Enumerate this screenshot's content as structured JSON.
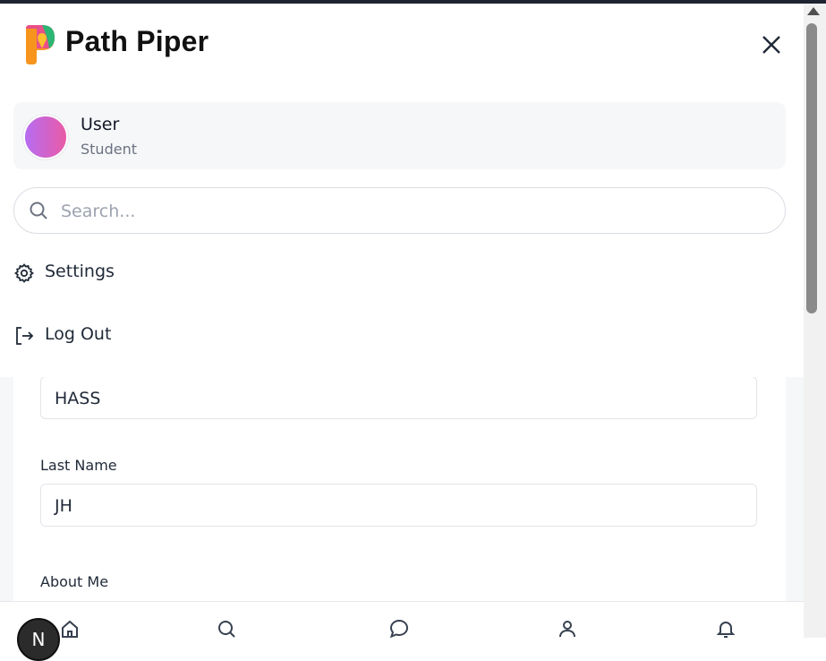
{
  "brand": {
    "name": "Path Piper"
  },
  "drawer": {
    "user": {
      "name": "User",
      "role": "Student"
    },
    "search": {
      "placeholder": "Search..."
    },
    "menu": [
      {
        "label": "Settings",
        "icon": "gear-icon"
      },
      {
        "label": "Log Out",
        "icon": "logout-icon"
      }
    ]
  },
  "form": {
    "first_name_value": "HASS",
    "last_name_label": "Last Name",
    "last_name_value": "JH",
    "about_me_label": "About Me"
  },
  "bottom_nav": {
    "badge_text": "N",
    "items": [
      "home-icon",
      "search-icon",
      "chat-icon",
      "profile-icon",
      "bell-icon"
    ]
  },
  "colors": {
    "avatar_gradient_start": "#b66cf2",
    "avatar_gradient_end": "#e95ba6",
    "logo_orange": "#f7941d",
    "logo_pink": "#e94f8a",
    "logo_green": "#2bb673",
    "logo_yellow": "#fbc02d"
  }
}
